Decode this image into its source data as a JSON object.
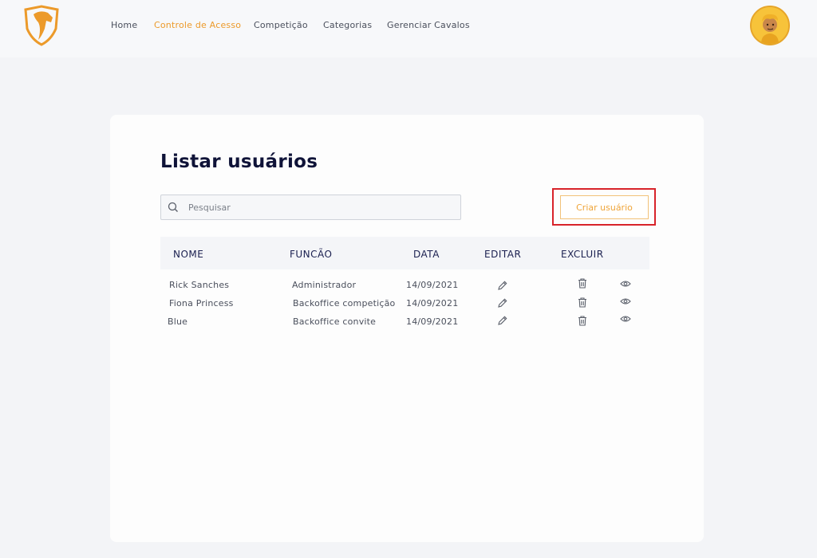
{
  "nav": {
    "items": [
      {
        "label": "Home",
        "active": false
      },
      {
        "label": "Controle de Acesso",
        "active": true
      },
      {
        "label": "Competição",
        "active": false
      },
      {
        "label": "Categorias",
        "active": false
      },
      {
        "label": "Gerenciar Cavalos",
        "active": false
      }
    ]
  },
  "page": {
    "title": "Listar usuários"
  },
  "search": {
    "placeholder": "Pesquisar",
    "icon": "search-icon"
  },
  "actions": {
    "create_label": "Criar usuário"
  },
  "table": {
    "headers": [
      "NOME",
      "FUNCÃO",
      "DATA",
      "EDITAR",
      "EXCLUIR"
    ],
    "rows": [
      {
        "nome": "Rick Sanches",
        "funcao": "Administrador",
        "data": "14/09/2021"
      },
      {
        "nome": "Fiona Princess",
        "funcao": "Backoffice competição",
        "data": "14/09/2021"
      },
      {
        "nome": "Blue",
        "funcao": "Backoffice convite",
        "data": "14/09/2021"
      }
    ],
    "row_icons": [
      "pencil-icon",
      "trash-icon",
      "eye-icon"
    ]
  },
  "colors": {
    "accent": "#ec9a2a",
    "title": "#0f1338",
    "highlight": "#d8232a"
  }
}
